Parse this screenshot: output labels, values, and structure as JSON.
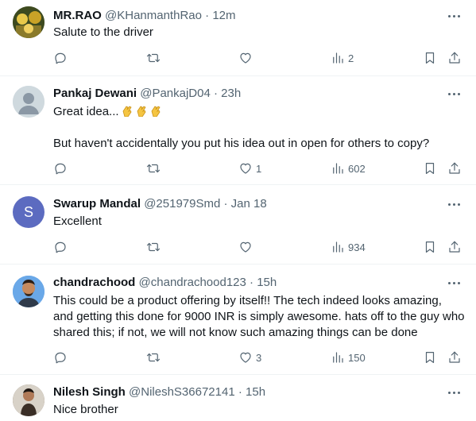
{
  "tweets": [
    {
      "name": "MR.RAO",
      "handle": "@KHanmanthRao",
      "sep": "·",
      "time": "12m",
      "text": "Salute to the driver",
      "views": "2",
      "likes": "",
      "avatar_color": "#5a6b2e"
    },
    {
      "name": "Pankaj Dewani",
      "handle": "@PankajD04",
      "sep": "·",
      "time": "23h",
      "text1": "Great idea...",
      "text2": "But haven't accidentally you put his idea out in open for others to copy?",
      "likes": "1",
      "views": "602",
      "avatar_color": "#cfd9de"
    },
    {
      "name": "Swarup Mandal",
      "handle": "@251979Smd",
      "sep": "·",
      "time": "Jan 18",
      "text": "Excellent",
      "views": "934",
      "avatar_letter": "S",
      "avatar_color": "#5c6bc0"
    },
    {
      "name": "chandrachood",
      "handle": "@chandrachood123",
      "sep": "·",
      "time": "15h",
      "text": "This could be a product offering by itself!! The tech indeed looks amazing, and getting this done for 9000 INR is simply awesome. hats off to the guy who shared this; if not, we will not know such amazing things can be done",
      "likes": "3",
      "views": "150",
      "avatar_color": "#4a90d9"
    },
    {
      "name": "Nilesh Singh",
      "handle": "@NileshS36672141",
      "sep": "·",
      "time": "15h",
      "text": "Nice brother",
      "avatar_color": "#6d5a4a"
    }
  ],
  "icons": {
    "reply": "reply-icon",
    "retweet": "retweet-icon",
    "like": "like-icon",
    "views": "views-icon",
    "bookmark": "bookmark-icon",
    "share": "share-icon",
    "more": "more-icon",
    "clap": "clapping-hands-emoji"
  },
  "colors": {
    "text": "#0f1419",
    "secondary": "#536471",
    "divider": "#eff3f4",
    "clap": "#f5c542"
  }
}
